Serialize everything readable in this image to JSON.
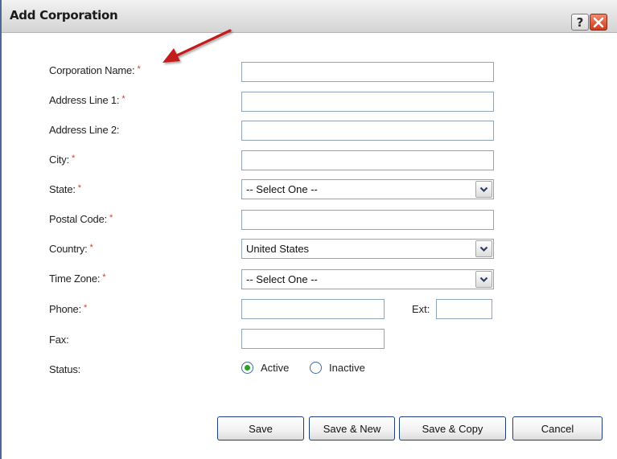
{
  "window": {
    "title": "Add Corporation",
    "help_label": "?"
  },
  "form": {
    "corporation_name": {
      "label": "Corporation Name:",
      "required": "*",
      "value": ""
    },
    "address_line_1": {
      "label": "Address Line 1:",
      "required": "*",
      "value": ""
    },
    "address_line_2": {
      "label": "Address Line 2:",
      "value": ""
    },
    "city": {
      "label": "City:",
      "required": "*",
      "value": ""
    },
    "state": {
      "label": "State:",
      "required": "*",
      "selected": "-- Select One --"
    },
    "postal_code": {
      "label": "Postal Code:",
      "required": "*",
      "value": ""
    },
    "country": {
      "label": "Country:",
      "required": "*",
      "selected": "United States"
    },
    "time_zone": {
      "label": "Time Zone:",
      "required": "*",
      "selected": "-- Select One --"
    },
    "phone": {
      "label": "Phone:",
      "required": "*",
      "value": ""
    },
    "ext": {
      "label": "Ext:",
      "value": ""
    },
    "fax": {
      "label": "Fax:",
      "value": ""
    },
    "status": {
      "label": "Status:",
      "options": [
        "Active",
        "Inactive"
      ],
      "selected": "Active"
    }
  },
  "buttons": {
    "save": "Save",
    "save_new": "Save & New",
    "save_copy": "Save & Copy",
    "cancel": "Cancel"
  },
  "colors": {
    "required_marker": "#d03a2a",
    "annotation_arrow": "#c41a1a",
    "close_button": "#cf3b1d",
    "radio_selected": "#2aa02a"
  }
}
